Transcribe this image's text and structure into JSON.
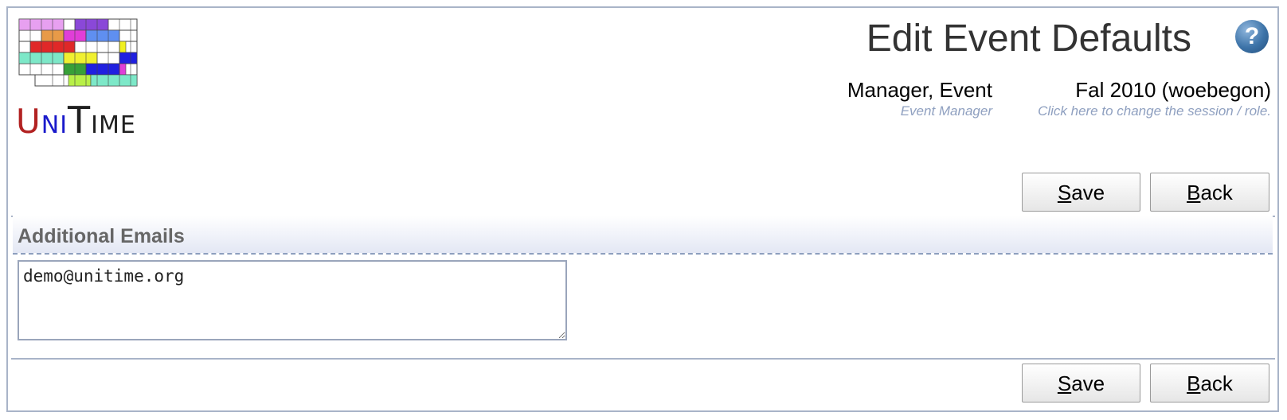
{
  "header": {
    "logo_text": "UniTime",
    "page_title": "Edit Event Defaults",
    "help_icon": "question-icon",
    "user": {
      "name": "Manager, Event",
      "role": "Event Manager"
    },
    "session": {
      "name": "Fal 2010 (woebegon)",
      "hint": "Click here to change the session / role."
    }
  },
  "toolbar": {
    "save_key": "S",
    "save_rest": "ave",
    "back_key": "B",
    "back_rest": "ack"
  },
  "section": {
    "title": "Additional Emails",
    "emails_value": "demo@unitime.org"
  },
  "colors": {
    "frame_border": "#a9b4c8",
    "hint_text": "#8fa0c0",
    "section_title": "#666666"
  }
}
